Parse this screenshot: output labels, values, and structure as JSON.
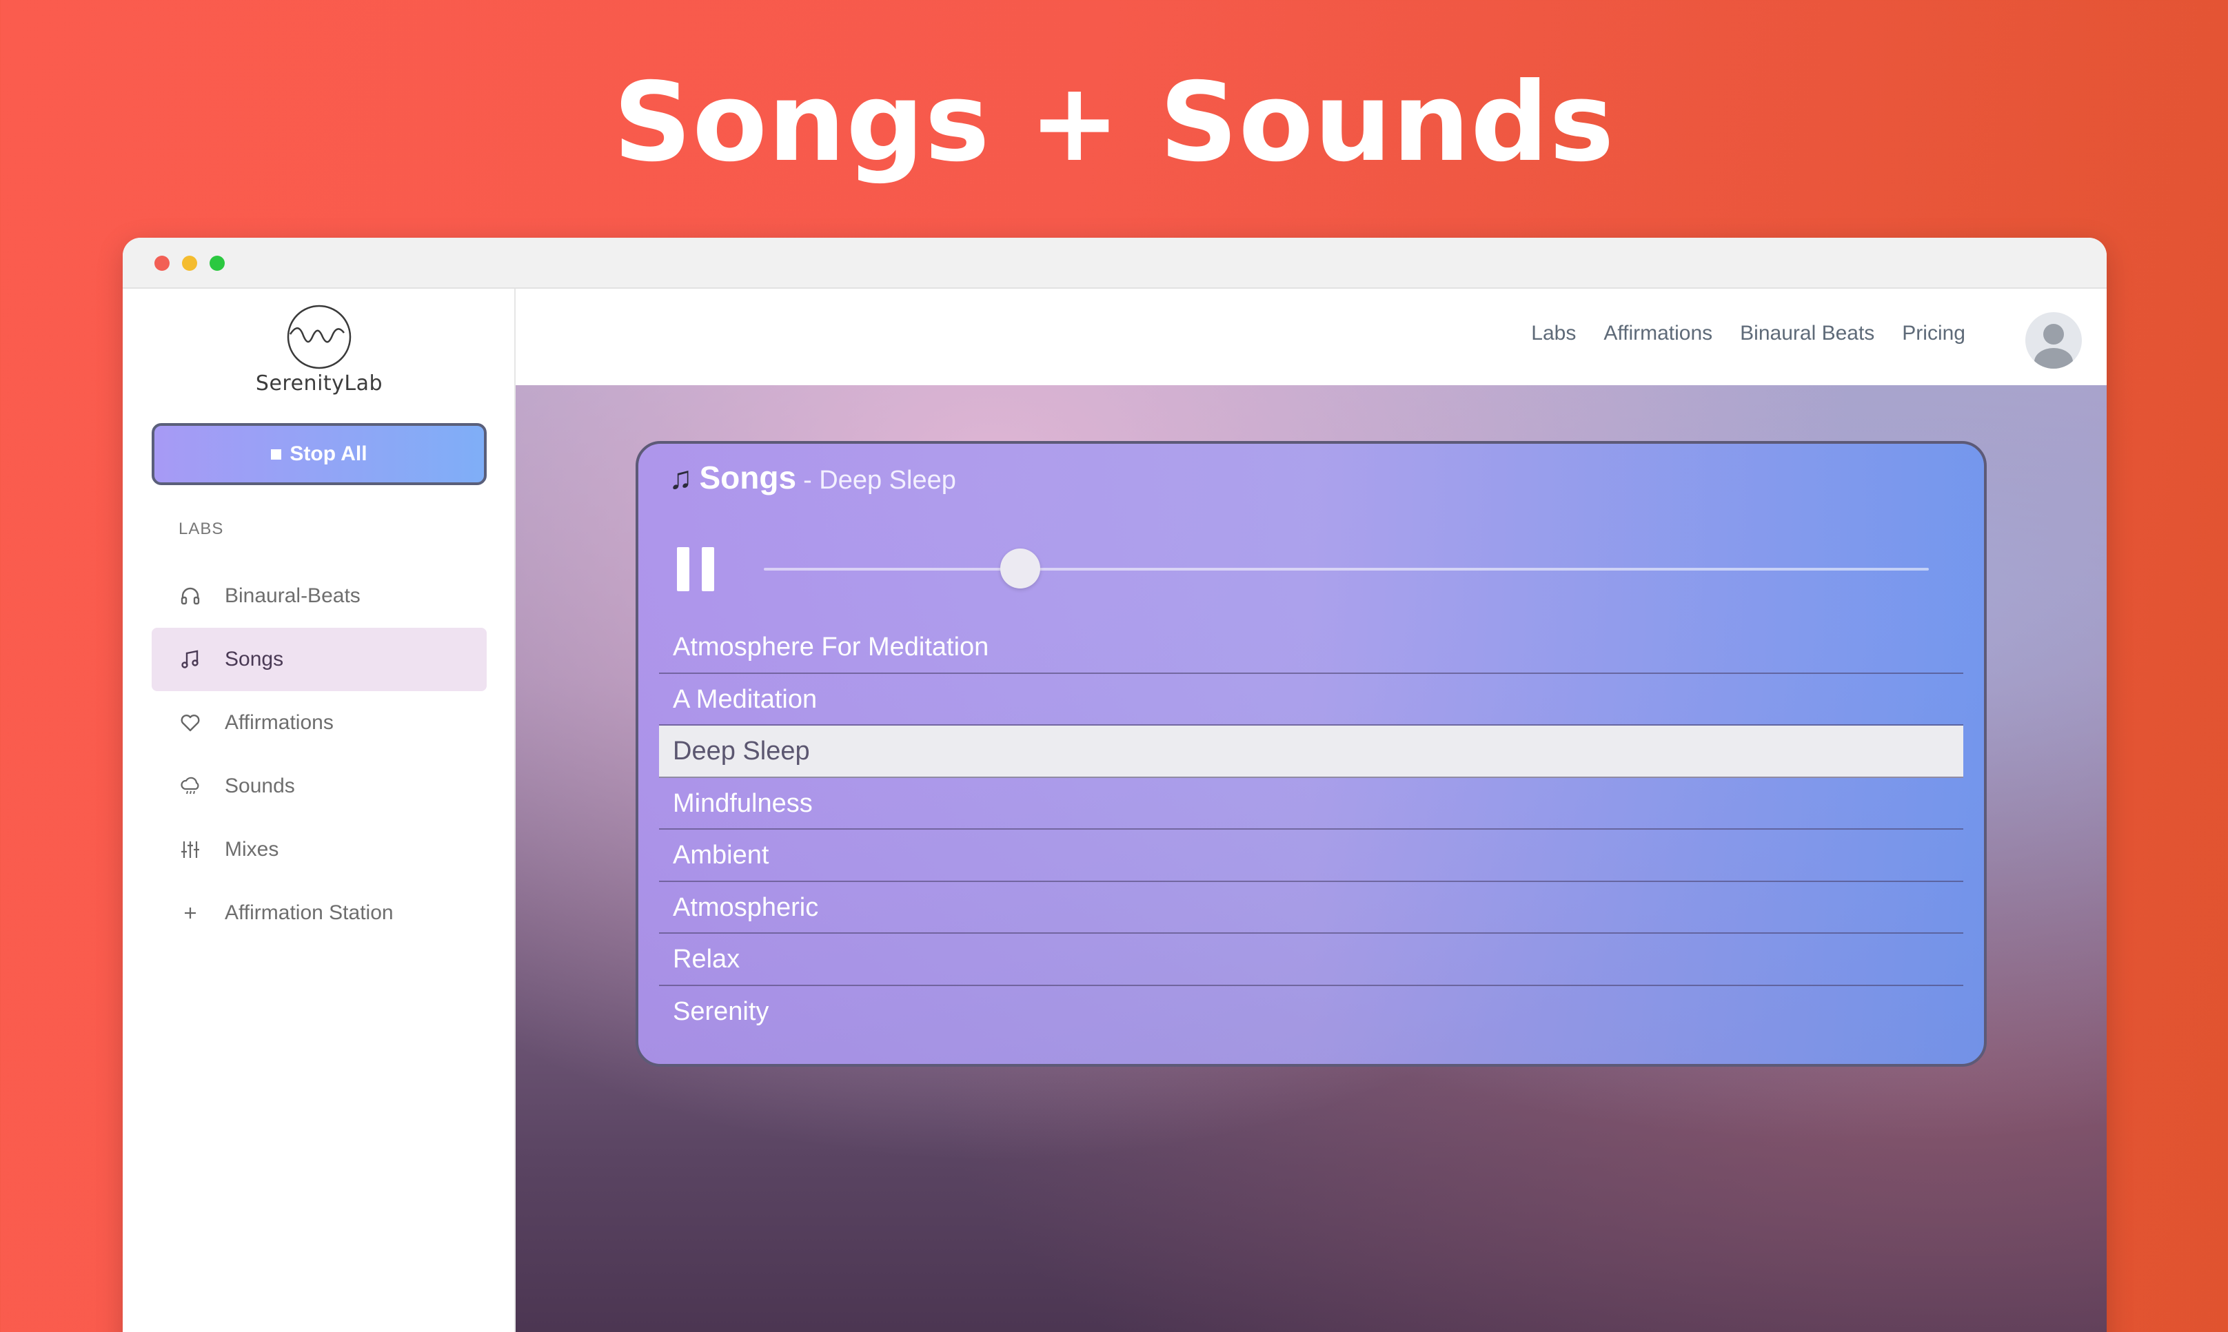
{
  "hero": {
    "title": "Songs + Sounds"
  },
  "app": {
    "logo_text": "SerenityLab"
  },
  "sidebar": {
    "stop_all_label": "Stop All",
    "section_label": "LABS",
    "items": [
      {
        "label": "Binaural-Beats",
        "icon": "headphones-icon",
        "active": false
      },
      {
        "label": "Songs",
        "icon": "music-note-icon",
        "active": true
      },
      {
        "label": "Affirmations",
        "icon": "heart-icon",
        "active": false
      },
      {
        "label": "Sounds",
        "icon": "rain-cloud-icon",
        "active": false
      },
      {
        "label": "Mixes",
        "icon": "sliders-icon",
        "active": false
      },
      {
        "label": "Affirmation Station",
        "icon": "plus-icon",
        "active": false
      }
    ]
  },
  "topnav": {
    "links": [
      "Labs",
      "Affirmations",
      "Binaural Beats",
      "Pricing"
    ]
  },
  "player": {
    "icon": "music-notes-icon",
    "title": "Songs",
    "subtitle": "- Deep Sleep",
    "state": "playing",
    "progress": 0.22,
    "songs": [
      "Atmosphere For Meditation",
      "A Meditation",
      "Deep Sleep",
      "Mindfulness",
      "Ambient",
      "Atmospheric",
      "Relax",
      "Serenity"
    ],
    "selected_index": 2
  },
  "colors": {
    "background": "#f65a4b",
    "accent_gradient_start": "#a79af5",
    "accent_gradient_end": "#7faef7",
    "active_nav_bg": "#efe2f1"
  }
}
